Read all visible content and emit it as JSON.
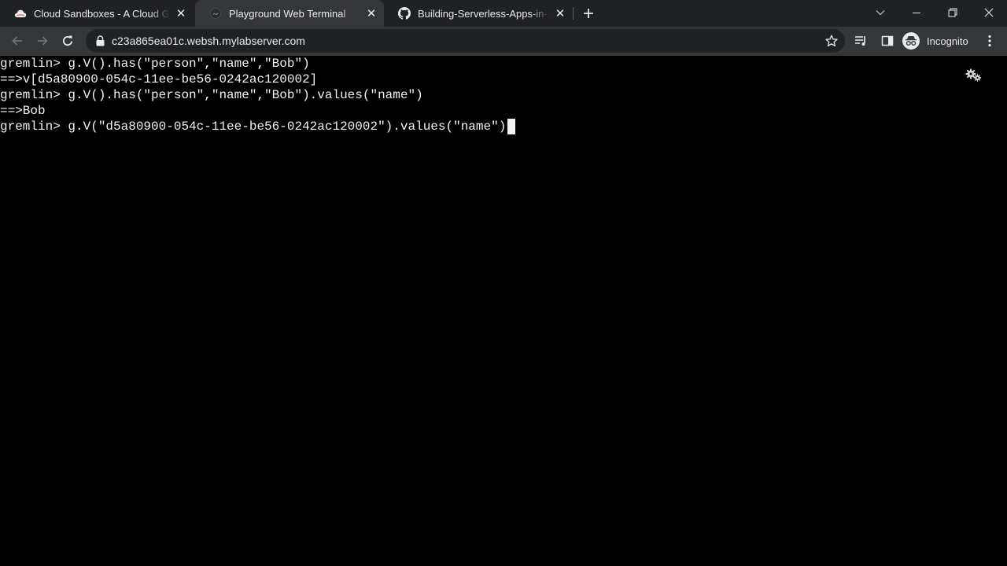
{
  "browser": {
    "tabs": [
      {
        "title": "Cloud Sandboxes - A Cloud Guru",
        "icon": "cloud-favicon-icon",
        "active": false
      },
      {
        "title": "Playground Web Terminal",
        "icon": "terminal-favicon-icon",
        "active": true
      },
      {
        "title": "Building-Serverless-Apps-in-AWS",
        "icon": "github-favicon-icon",
        "active": false
      }
    ],
    "url": "c23a865ea01c.websh.mylabserver.com",
    "profile_label": "Incognito",
    "colors": {
      "tab_strip": "#202124",
      "active_tab": "#35363a",
      "omnibox": "#202124",
      "accent_red": "#e57373"
    }
  },
  "terminal": {
    "lines": [
      "gremlin> g.V().has(\"person\",\"name\",\"Bob\")",
      "==>v[d5a80900-054c-11ee-be56-0242ac120002]",
      "gremlin> g.V().has(\"person\",\"name\",\"Bob\").values(\"name\")",
      "==>Bob",
      "gremlin> g.V(\"d5a80900-054c-11ee-be56-0242ac120002\").values(\"name\")"
    ],
    "colors": {
      "background": "#000000",
      "text": "#f2f2f2"
    },
    "settings_icon": "settings-gears-icon"
  }
}
